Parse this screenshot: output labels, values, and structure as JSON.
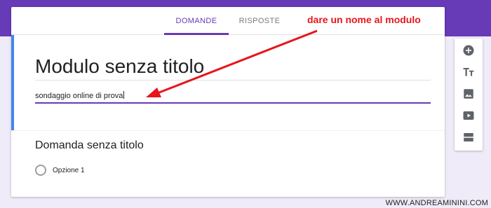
{
  "tabs": {
    "questions": "DOMANDE",
    "responses": "RISPOSTE"
  },
  "form": {
    "title": "Modulo senza titolo",
    "description": "sondaggio online di prova"
  },
  "question": {
    "title": "Domanda senza titolo",
    "option_1": "Opzione 1"
  },
  "toolbar": {
    "icons": [
      "add-circle-icon",
      "text-title-icon",
      "image-icon",
      "video-icon",
      "section-icon"
    ]
  },
  "annotation": {
    "text": "dare un nome al modulo",
    "color": "#e8151b"
  },
  "watermark": "WWW.ANDREAMININI.COM",
  "colors": {
    "accent": "#673ab7",
    "focus_bar": "#4285f4",
    "background": "#f0ebf8"
  }
}
